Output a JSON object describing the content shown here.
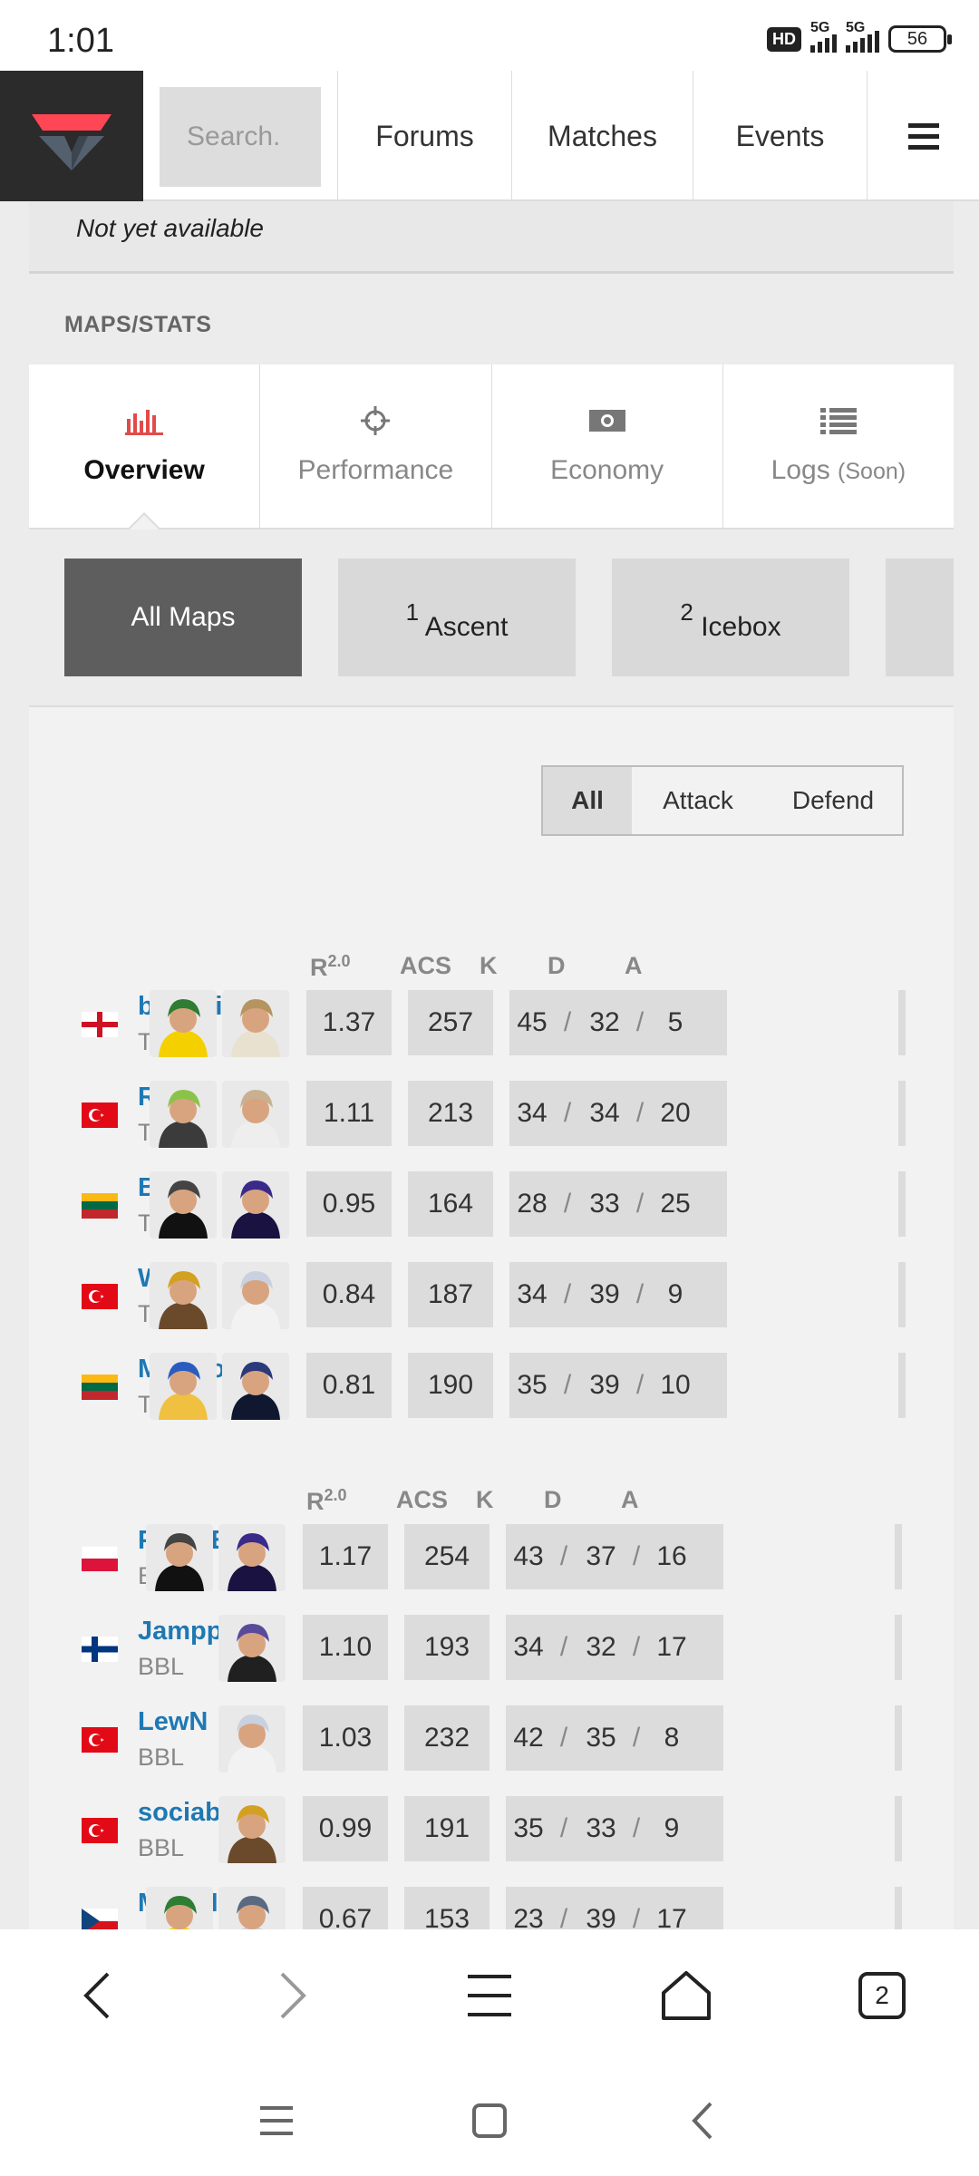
{
  "status": {
    "time": "1:01",
    "hd": "HD",
    "net1": "5G",
    "net2": "5G",
    "battery": "56"
  },
  "nav": {
    "search_placeholder": "Search.",
    "links": [
      "Forums",
      "Matches",
      "Events"
    ]
  },
  "top_card": {
    "note": "Not yet available"
  },
  "section_label": "MAPS/STATS",
  "tabs": [
    {
      "label": "Overview",
      "icon": "bar-chart-icon",
      "active": true
    },
    {
      "label": "Performance",
      "icon": "crosshair-icon"
    },
    {
      "label": "Economy",
      "icon": "money-icon"
    },
    {
      "label": "Logs",
      "soon": "(Soon)",
      "icon": "list-icon"
    }
  ],
  "maps": [
    {
      "label": "All Maps"
    },
    {
      "num": "1",
      "label": "Ascent"
    },
    {
      "num": "2",
      "label": "Icebox"
    }
  ],
  "side_filter": [
    "All",
    "Attack",
    "Defend"
  ],
  "columns": {
    "rating": "R",
    "rating_sup": "2.0",
    "acs": "ACS",
    "k": "K",
    "d": "D",
    "a": "A",
    "slash": "/"
  },
  "teams": [
    {
      "players": [
        {
          "name": "benjyfishy",
          "team": "TH",
          "flag": "england",
          "agents": [
            "viper",
            "sova"
          ],
          "rating": "1.37",
          "acs": "257",
          "k": "45",
          "d": "32",
          "a": "5"
        },
        {
          "name": "RieNs",
          "team": "TH",
          "flag": "turkey",
          "agents": [
            "kayo-green",
            "breach"
          ],
          "rating": "1.11",
          "acs": "213",
          "k": "34",
          "d": "34",
          "a": "20"
        },
        {
          "name": "Boo",
          "team": "TH",
          "flag": "lithuania",
          "agents": [
            "reyna",
            "omen"
          ],
          "rating": "0.95",
          "acs": "164",
          "k": "28",
          "d": "33",
          "a": "25"
        },
        {
          "name": "Wo0t",
          "team": "TH",
          "flag": "turkey",
          "agents": [
            "phoenix",
            "jett"
          ],
          "rating": "0.84",
          "acs": "187",
          "k": "34",
          "d": "39",
          "a": "9"
        },
        {
          "name": "MiniBoo",
          "team": "TH",
          "flag": "lithuania",
          "agents": [
            "neon",
            "yoru"
          ],
          "rating": "0.81",
          "acs": "190",
          "k": "35",
          "d": "39",
          "a": "10"
        }
      ]
    },
    {
      "players": [
        {
          "name": "PROFEK",
          "team": "BBL",
          "flag": "poland",
          "agents": [
            "reyna",
            "omen"
          ],
          "rating": "1.17",
          "acs": "254",
          "k": "43",
          "d": "37",
          "a": "16"
        },
        {
          "name": "Jamppi",
          "team": "BBL",
          "flag": "finland",
          "agents": [
            "kayo"
          ],
          "rating": "1.10",
          "acs": "193",
          "k": "34",
          "d": "32",
          "a": "17"
        },
        {
          "name": "LewN",
          "team": "BBL",
          "flag": "turkey",
          "agents": [
            "jett"
          ],
          "rating": "1.03",
          "acs": "232",
          "k": "42",
          "d": "35",
          "a": "8"
        },
        {
          "name": "sociablEE",
          "team": "BBL",
          "flag": "turkey",
          "agents": [
            "phoenix"
          ],
          "rating": "0.99",
          "acs": "191",
          "k": "35",
          "d": "33",
          "a": "9"
        },
        {
          "name": "MAGNUM",
          "team": "BBL",
          "flag": "czechia",
          "agents": [
            "viper",
            "fade"
          ],
          "rating": "0.67",
          "acs": "153",
          "k": "23",
          "d": "39",
          "a": "17"
        }
      ]
    }
  ],
  "browser": {
    "tab_count": "2"
  }
}
